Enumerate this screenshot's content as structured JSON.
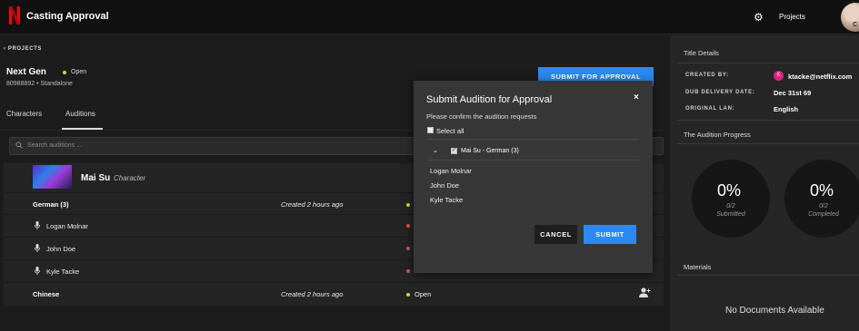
{
  "app": {
    "title": "Casting Approval",
    "projects_link": "Projects",
    "avatar_initial": "C"
  },
  "breadcrumb": {
    "label": "PROJECTS"
  },
  "project": {
    "name": "Next Gen",
    "status": "Open",
    "subtitle": "80988892 • Standalone",
    "submit_label": "SUBMIT FOR APPROVAL"
  },
  "tabs": [
    {
      "label": "Characters"
    },
    {
      "label": "Auditions",
      "active": true
    }
  ],
  "search": {
    "placeholder": "Search auditions ..."
  },
  "character": {
    "name": "Mai Su",
    "type": "Character"
  },
  "groups": [
    {
      "language": "German (3)",
      "created": "Created 2 hours ago"
    },
    {
      "language": "Chinese",
      "created": "Created 2 hours ago",
      "status": "Open"
    }
  ],
  "performers": [
    {
      "name": "Logan Molnar"
    },
    {
      "name": "John Doe"
    },
    {
      "name": "Kyle Tacke"
    }
  ],
  "details": {
    "heading": "Title Details",
    "created_by_label": "CREATED BY:",
    "created_by_initial": "K",
    "created_by_value": "ktacke@netflix.com",
    "dub_label": "DUB DELIVERY DATE:",
    "dub_value": "Dec 31st 69",
    "orig_label": "ORIGINAL LAN:",
    "orig_value": "English"
  },
  "progress": {
    "heading": "The Audition Progress",
    "submitted": {
      "pct": "0%",
      "count": "0/2",
      "label": "Submitted"
    },
    "completed": {
      "pct": "0%",
      "count": "0/2",
      "label": "Completed"
    }
  },
  "materials": {
    "heading": "Materials",
    "empty": "No Documents Available"
  },
  "modal": {
    "title": "Submit Audition for Approval",
    "close": "×",
    "description": "Please confirm the audition requests",
    "select_all": "Select all",
    "group_label": "Mai Su - German (3)",
    "people": [
      "Logan Molnar",
      "John Doe",
      "Kyle Tacke"
    ],
    "cancel": "CANCEL",
    "submit": "SUBMIT"
  },
  "colors": {
    "accent": "#2a8af0",
    "open_dot": "#c8d84a",
    "pending_dot": "#e05050",
    "brand": "#e50914",
    "badge": "#e0207a"
  }
}
